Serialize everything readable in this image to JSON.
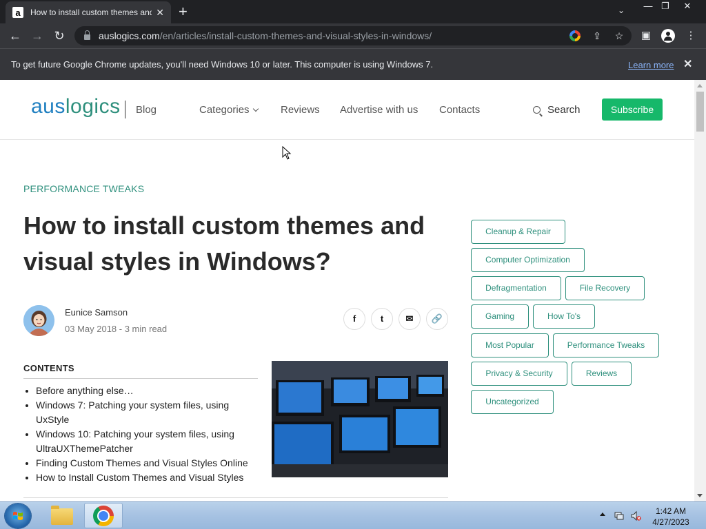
{
  "browser": {
    "tab": {
      "favicon_letter": "a",
      "title": "How to install custom themes and visual styles in Windows?",
      "close": "✕"
    },
    "new_tab": "+",
    "tab_search": "⌄",
    "window_controls": {
      "minimize": "—",
      "restore": "❐",
      "close": "✕"
    },
    "nav": {
      "back": "←",
      "forward": "→",
      "reload": "↻"
    },
    "url_host": "auslogics.com",
    "url_path": "/en/articles/install-custom-themes-and-visual-styles-in-windows/",
    "toolbar_icons": {
      "share": "⇪",
      "bookmark": "☆",
      "sidepanel": "▣",
      "menu": "⋮"
    }
  },
  "infobar": {
    "message": "To get future Google Chrome updates, you'll need Windows 10 or later. This computer is using Windows 7.",
    "link": "Learn more",
    "close": "✕"
  },
  "site": {
    "logo_part1": "aus",
    "logo_part2": "logics",
    "blog": "Blog",
    "nav": [
      "Categories",
      "Reviews",
      "Advertise with us",
      "Contacts"
    ],
    "search": "Search",
    "subscribe": "Subscribe"
  },
  "article": {
    "category": "PERFORMANCE TWEAKS",
    "title": "How to install custom themes and visual styles in Windows?",
    "author": "Eunice Samson",
    "meta": "03 May 2018 - 3 min read",
    "share": [
      "f",
      "t",
      "✉",
      "🔗"
    ],
    "contents_heading": "CONTENTS",
    "toc": [
      "Before anything else…",
      "Windows 7: Patching your system files, using UxStyle",
      "Windows 10: Patching your system files, using UltraUXThemePatcher",
      "Finding Custom Themes and Visual Styles Online",
      "How to Install Custom Themes and Visual Styles"
    ]
  },
  "tags": [
    "Cleanup & Repair",
    "Computer Optimization",
    "Defragmentation",
    "File Recovery",
    "Gaming",
    "How To's",
    "Most Popular",
    "Performance Tweaks",
    "Privacy & Security",
    "Reviews",
    "Uncategorized"
  ],
  "taskbar": {
    "time": "1:42 AM",
    "date": "4/27/2023"
  }
}
